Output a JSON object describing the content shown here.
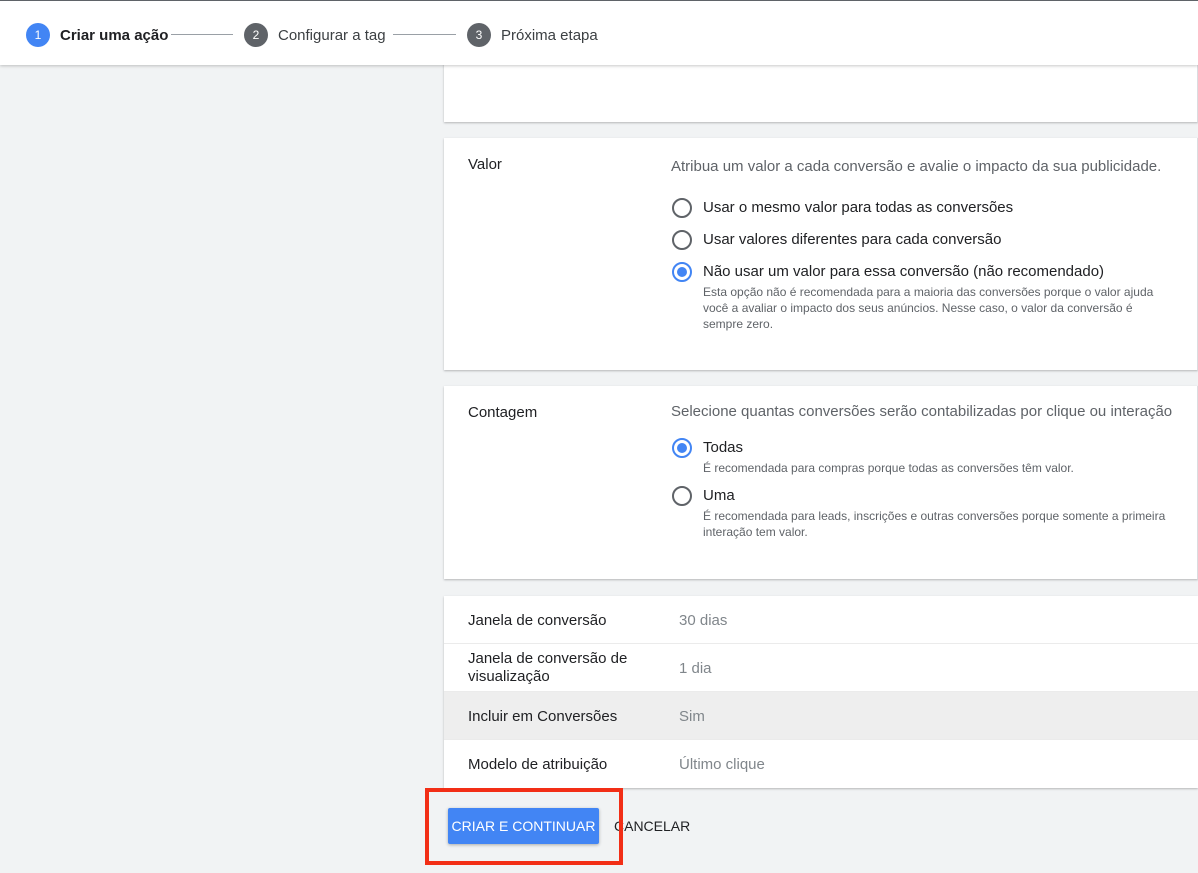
{
  "stepper": {
    "steps": [
      {
        "number": "1",
        "label": "Criar uma ação",
        "active": true
      },
      {
        "number": "2",
        "label": "Configurar a tag",
        "active": false
      },
      {
        "number": "3",
        "label": "Próxima etapa",
        "active": false
      }
    ]
  },
  "valor": {
    "title": "Valor",
    "description": "Atribua um valor a cada conversão e avalie o impacto da sua publicidade.",
    "options": [
      {
        "label": "Usar o mesmo valor para todas as conversões",
        "checked": false
      },
      {
        "label": "Usar valores diferentes para cada conversão",
        "checked": false
      },
      {
        "label": "Não usar um valor para essa conversão (não recomendado)",
        "checked": true,
        "help": "Esta opção não é recomendada para a maioria das conversões porque o valor ajuda você a avaliar o impacto dos seus anúncios. Nesse caso, o valor da conversão é sempre zero."
      }
    ]
  },
  "contagem": {
    "title": "Contagem",
    "description": "Selecione quantas conversões serão contabilizadas por clique ou interação",
    "options": [
      {
        "label": "Todas",
        "checked": true,
        "help": "É recomendada para compras porque todas as conversões têm valor."
      },
      {
        "label": "Uma",
        "checked": false,
        "help": "É recomendada para leads, inscrições e outras conversões porque somente a primeira interação tem valor."
      }
    ]
  },
  "settings": [
    {
      "label": "Janela de conversão",
      "value": "30 dias"
    },
    {
      "label": "Janela de conversão de visualização",
      "value": "1 dia"
    },
    {
      "label": "Incluir em Conversões",
      "value": "Sim"
    },
    {
      "label": "Modelo de atribuição",
      "value": "Último clique"
    }
  ],
  "actions": {
    "primary_label": "CRIAR E CONTINUAR",
    "cancel_label": "CANCELAR"
  },
  "colors": {
    "accent": "#4285f4",
    "highlight": "#f22e16"
  }
}
